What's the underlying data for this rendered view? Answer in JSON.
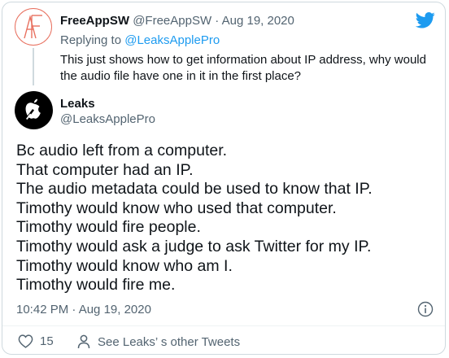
{
  "reply_tweet": {
    "display_name": "FreeAppSW",
    "handle": "@FreeAppSW",
    "separator": " · ",
    "date": "Aug 19, 2020",
    "replying_prefix": "Replying to ",
    "replying_to": "@LeaksApplePro",
    "text": "This just shows how to get information about IP address, why would the audio file have one in it in the first place?"
  },
  "main_tweet": {
    "display_name": "Leaks",
    "handle": "@LeaksApplePro",
    "lines": [
      "Bc audio left from a computer.",
      "That computer had an IP.",
      "The audio metadata could be used to know that IP.",
      "Timothy would know who used that computer.",
      "Timothy would fire people.",
      "Timothy would ask a judge to ask Twitter for my IP.",
      "Timothy would know who am I.",
      "Timothy would fire me."
    ],
    "timestamp": "10:42 PM · Aug 19, 2020"
  },
  "actions": {
    "like_count": "15",
    "other_tweets_label": "See Leaks’ s other Tweets"
  },
  "icons": {
    "brand": "twitter-bird-icon",
    "info": "info-icon",
    "like": "heart-icon",
    "profile": "person-icon"
  },
  "colors": {
    "accent": "#1d9bf0",
    "muted": "#536471",
    "text": "#0f1419",
    "avatar_outline": "#e8705f"
  }
}
